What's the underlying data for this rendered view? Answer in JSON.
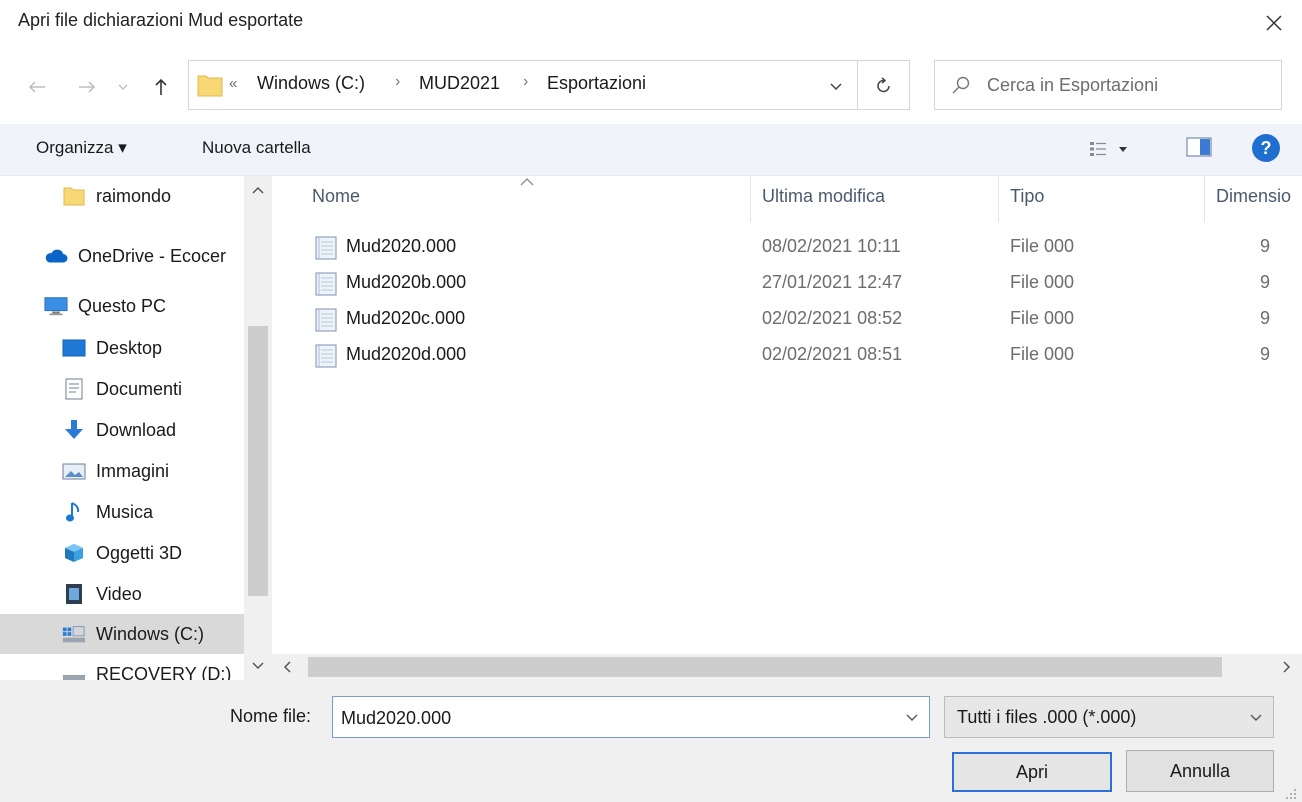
{
  "window": {
    "title": "Apri file dichiarazioni Mud esportate"
  },
  "address": {
    "chevrons": "«",
    "crumbs": [
      "Windows (C:)",
      "MUD2021",
      "Esportazioni"
    ],
    "separator": "›"
  },
  "search": {
    "placeholder": "Cerca in Esportazioni"
  },
  "toolbar": {
    "organizza_label": "Organizza ▾",
    "nuova_label": "Nuova cartella",
    "help_label": "?"
  },
  "nav": {
    "items": [
      {
        "label": "raimondo",
        "icon": "folder-icon"
      },
      {
        "label": "OneDrive - Ecocer",
        "icon": "cloud-icon"
      },
      {
        "label": "Questo PC",
        "icon": "computer-icon"
      },
      {
        "label": "Desktop",
        "icon": "desktop-icon"
      },
      {
        "label": "Documenti",
        "icon": "documents-icon"
      },
      {
        "label": "Download",
        "icon": "download-icon"
      },
      {
        "label": "Immagini",
        "icon": "pictures-icon"
      },
      {
        "label": "Musica",
        "icon": "music-icon"
      },
      {
        "label": "Oggetti 3D",
        "icon": "objects-3d-icon"
      },
      {
        "label": "Video",
        "icon": "video-icon"
      },
      {
        "label": "Windows (C:)",
        "icon": "drive-icon"
      },
      {
        "label": "RECOVERY (D:)",
        "icon": "drive-icon"
      }
    ],
    "selected_index": 10
  },
  "files": {
    "columns": [
      "Nome",
      "Ultima modifica",
      "Tipo",
      "Dimensio"
    ],
    "rows": [
      {
        "name": "Mud2020.000",
        "modified": "08/02/2021 10:11",
        "type": "File 000",
        "size": "9"
      },
      {
        "name": "Mud2020b.000",
        "modified": "27/01/2021 12:47",
        "type": "File 000",
        "size": "9"
      },
      {
        "name": "Mud2020c.000",
        "modified": "02/02/2021 08:52",
        "type": "File 000",
        "size": "9"
      },
      {
        "name": "Mud2020d.000",
        "modified": "02/02/2021 08:51",
        "type": "File 000",
        "size": "9"
      }
    ]
  },
  "bottom": {
    "filename_label": "Nome file:",
    "filename_value": "Mud2020.000",
    "filter_value": "Tutti i files .000 (*.000)",
    "open_label": "Apri",
    "cancel_label": "Annulla"
  },
  "colors": {
    "accent": "#2d6fd6",
    "toolbar_bg": "#f0f3f9",
    "selected_bg": "#d9d9d9",
    "folder_yellow": "#f8d775",
    "help_blue": "#1f6fd1"
  }
}
